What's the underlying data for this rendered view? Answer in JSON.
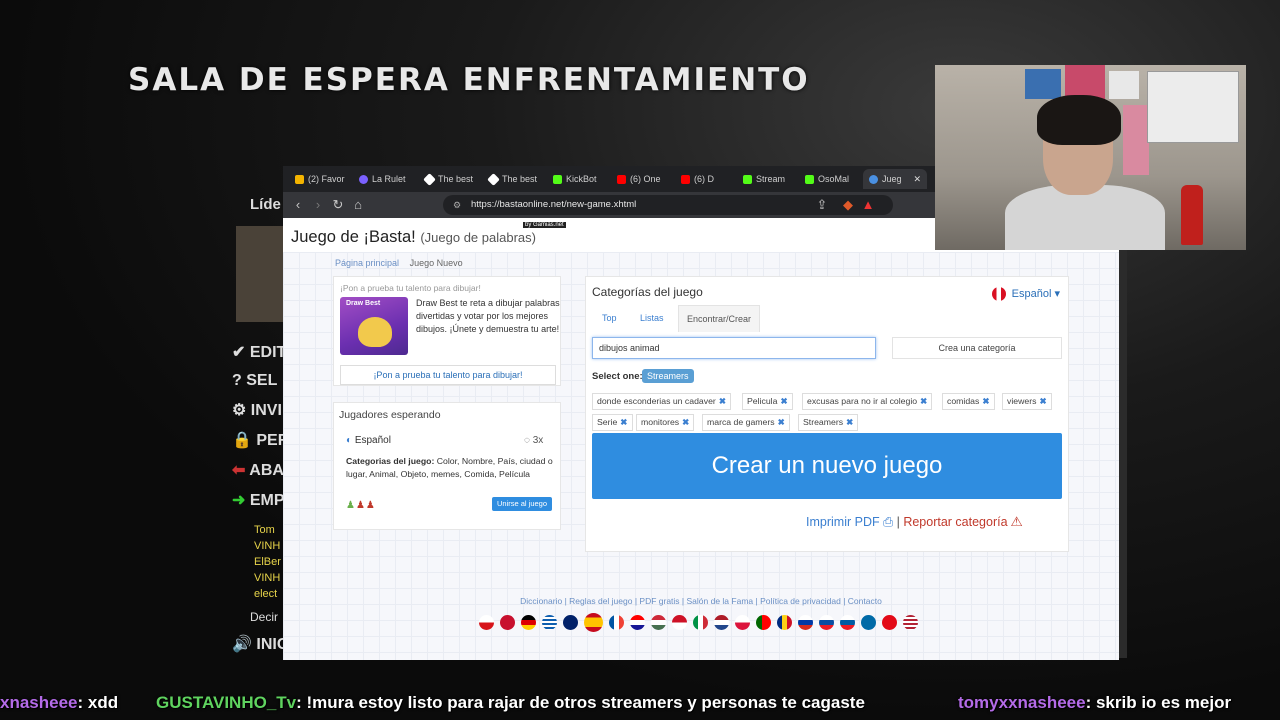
{
  "stream": {
    "title": "SALA DE ESPERA ENFRENTAMIENTO",
    "side_label": "Líde",
    "menu": [
      "EDIT",
      "SEL",
      "INVI",
      "PER",
      "ABA",
      "EMP",
      "Decir",
      "INIC"
    ],
    "side_names": [
      "Tom",
      "VINH",
      "ElBer",
      "VINH",
      "elect"
    ],
    "chat": [
      {
        "user": "xnasheee",
        "msg": ": xdd",
        "color": "#b46be8"
      },
      {
        "user": "GUSTAVINHO_Tv",
        "msg": ": !mura estoy listo para rajar de otros streamers y personas te cagaste",
        "color": "#5fd35f"
      },
      {
        "user": "tomyxxnasheee",
        "msg": ": skrib io es mejor",
        "color": "#b46be8"
      }
    ]
  },
  "browser": {
    "tabs": [
      {
        "label": "(2) Favor",
        "color": "#f4b400"
      },
      {
        "label": "La Rulet",
        "color": "#7b61ff"
      },
      {
        "label": "The best",
        "color": "#ffffff"
      },
      {
        "label": "The best",
        "color": "#ffffff"
      },
      {
        "label": "KickBot",
        "color": "#53fc18"
      },
      {
        "label": "(6) One",
        "color": "#ff0000"
      },
      {
        "label": "(6) D",
        "color": "#ff0000"
      },
      {
        "label": "Stream",
        "color": "#53fc18"
      },
      {
        "label": "OsoMal",
        "color": "#53fc18"
      },
      {
        "label": "Jueg",
        "color": "#4a90e2"
      }
    ],
    "url": "https://bastaonline.net/new-game.xhtml"
  },
  "page": {
    "title": "Juego de ¡Basta!",
    "subtitle": "(Juego de palabras)",
    "gamias": "by Gamias.net",
    "breadcrumb": {
      "home": "Página principal",
      "current": "Juego Nuevo"
    },
    "promo": {
      "heading": "¡Pon a prueba tu talento para dibujar!",
      "image_label": "Draw Best",
      "text": "Draw Best te reta a dibujar palabras divertidas y votar por los mejores dibujos. ¡Únete y demuestra tu arte!",
      "button": "¡Pon a prueba tu talento para dibujar!"
    },
    "players": {
      "title": "Jugadores esperando",
      "language": "Español",
      "count": "3x",
      "categories_label": "Categorias del juego:",
      "categories": "Color, Nombre, País, ciudad o lugar, Animal, Objeto, memes, Comida, Película",
      "join": "Unirse al juego"
    },
    "categories": {
      "title": "Categorías del juego",
      "language": "Español",
      "tabs": [
        "Top",
        "Listas",
        "Encontrar/Crear"
      ],
      "input_value": "dibujos animad",
      "create_button": "Crea una categoría",
      "select_label": "Select one:",
      "selected_badge": "Streamers",
      "chips": [
        "donde esconderias un cadaver",
        "Pelicula",
        "excusas para no ir al colegio",
        "comidas",
        "viewers",
        "Serie",
        "monitores",
        "marca de gamers",
        "Streamers"
      ],
      "create_game": "Crear un nuevo juego",
      "print_pdf": "Imprimir PDF",
      "report": "Reportar categoría"
    },
    "footer": {
      "links": [
        "Diccionario",
        "Reglas del juego",
        "PDF gratis",
        "Salón de la Fama",
        "Política de privacidad",
        "Contacto"
      ]
    }
  }
}
